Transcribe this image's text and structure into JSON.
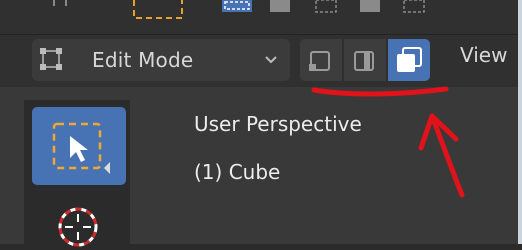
{
  "header": {
    "mode_label": "Edit Mode",
    "view_menu": "View"
  },
  "select_modes": [
    {
      "icon": "vertex-select-icon",
      "active": false
    },
    {
      "icon": "edge-select-icon",
      "active": false
    },
    {
      "icon": "face-select-icon",
      "active": true
    }
  ],
  "toolbar": {
    "tools": [
      {
        "icon": "select-box-icon",
        "active": true
      },
      {
        "icon": "cursor-icon",
        "active": false
      }
    ]
  },
  "viewport": {
    "perspective_label": "User Perspective",
    "object_label": "(1) Cube"
  },
  "colors": {
    "accent": "#4772b3",
    "annotation": "#e0121a",
    "background": "#393939"
  }
}
